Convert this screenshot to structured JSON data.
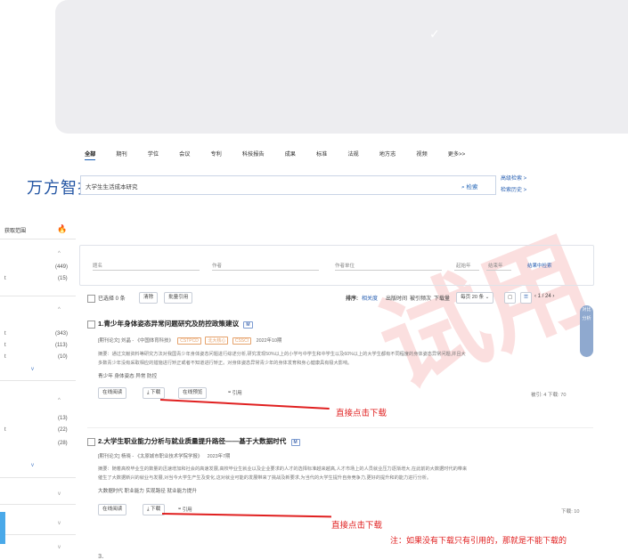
{
  "watermark": "试用",
  "top_card": {
    "check_glyph": "✓"
  },
  "nav": {
    "items": [
      "全部",
      "期刊",
      "学位",
      "会议",
      "专利",
      "科技报告",
      "成果",
      "标准",
      "法规",
      "地方志",
      "视频",
      "更多>>"
    ],
    "active": "全部"
  },
  "logo": "万方智搜",
  "search": {
    "query": "大学生生活成本研究",
    "button": "检索",
    "advanced": "高级检索 >",
    "history": "检索历史 >"
  },
  "sidebar": {
    "header": "获取范围",
    "counts": [
      "(449)",
      "(15)",
      "(343)",
      "(113)",
      "(10)",
      "(13)",
      "(22)",
      "(28)"
    ],
    "letters": [
      "t",
      "t",
      "t",
      "t",
      "t"
    ]
  },
  "filter": {
    "labels": [
      "题名",
      "作者",
      "作者单位",
      "起始年",
      "结束年"
    ],
    "search_in_result": "结果中检索"
  },
  "toolbar": {
    "selected": "已选择 0 条",
    "clear": "清除",
    "export": "批量引用",
    "sort_label": "排序:",
    "sort_options": [
      "相关度",
      "出版时间",
      "被引频次",
      "下载量"
    ],
    "page_size": "每页 20 条",
    "pager": "1 / 24"
  },
  "results": [
    {
      "title_prefix": "1.",
      "title": "青少年身体姿态异常问题研究及防控政策建议",
      "badge": "M",
      "meta": "[期刊论文] 刘晶 - 《中国体育科技》",
      "tags": [
        "CSTPCD",
        "北大核心",
        "CSSCI"
      ],
      "date": "2022年10期",
      "abstract_1": "摘要：通过文献资料等研究方法对我国青少年身体姿态问题进行综述分析,研究发现50%以上的小学与中学生和中学生以及60%以上的大学生都有不同程度的身体姿态异常问题,并且大",
      "abstract_2": "多数青少年没有采取相应的措施进行矫正或者不知道进行矫正。对身体姿态异常青少年的身体发育和身心健康具有极大影响。",
      "keywords": "青少年  身体姿态  异常  防控",
      "buttons": [
        "在线阅读",
        "下载",
        "在线预览",
        "引用"
      ],
      "stats": "被引: 4   下载: 70",
      "annotation": "直接点击下载"
    },
    {
      "title_prefix": "2.",
      "title": "大学生职业能力分析与就业质量提升路径——基于大数据时代",
      "badge": "M",
      "meta": "[期刊论文] 杨晓 - 《太原城市职业技术学院学报》",
      "date": "2023年7期",
      "abstract_1": "摘要：随着高校毕业生的数量的迅速增加和社会的高速发展,高校毕业生就业以及企业要求的人才的选择标准越来越高,人才市场上的人员就业压力逐渐增大,在此前的大数据时代的带来",
      "abstract_2": "催生了大数据新兴的就业与发展,对当今大学生产生及变化,这对就业可能的发展带来了挑战及新要求,为当代的大学生提升自身竞争力,更好的提升和的能力进行分析。",
      "keywords": "大数据时代  职业能力  实现路径  就业能力提升",
      "buttons": [
        "在线阅读",
        "下载",
        "引用"
      ],
      "stats": "下载: 10",
      "annotation": "直接点击下载",
      "note": "注：如果没有下载只有引用的，那就是不能下载的"
    }
  ],
  "next_result_partial": "3.",
  "side_tool": "对比 分析"
}
